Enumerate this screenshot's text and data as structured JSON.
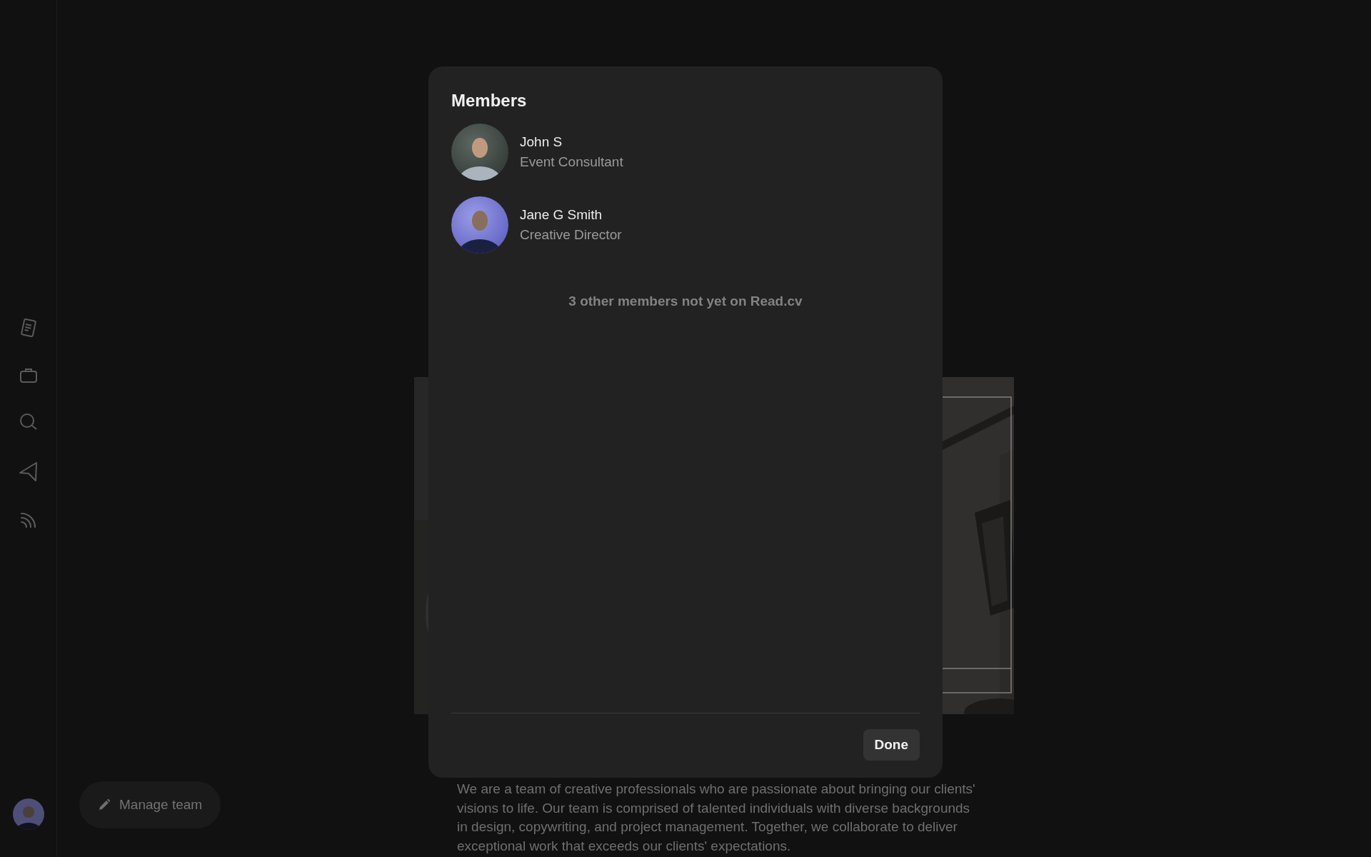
{
  "modal": {
    "title": "Members",
    "members": [
      {
        "name": "John S",
        "role": "Event Consultant"
      },
      {
        "name": "Jane G Smith",
        "role": "Creative Director"
      }
    ],
    "note": "3 other members not yet on Read.cv",
    "done_button": "Done"
  },
  "manage_team_button": "Manage team",
  "about_text": "We are a team of creative professionals who are passionate about bringing our clients' visions to life. Our team is comprised of talented individuals with diverse backgrounds in design, copywriting, and project management. Together, we collaborate to deliver exceptional work that exceeds our clients' expectations."
}
